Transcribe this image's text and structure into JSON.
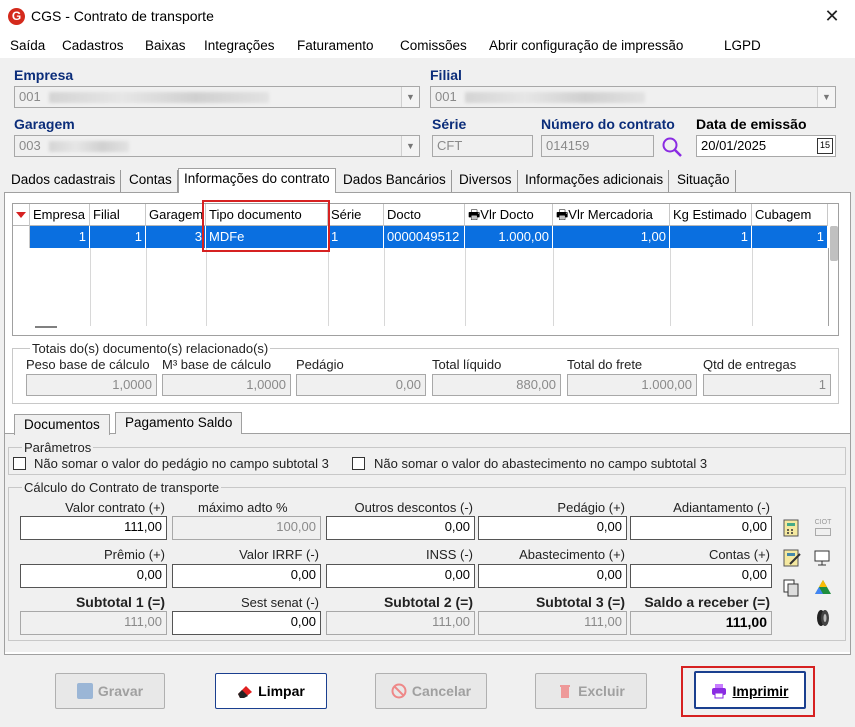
{
  "window": {
    "title": "CGS - Contrato de transporte",
    "close": "✕"
  },
  "menu": [
    "Saída",
    "Cadastros",
    "Baixas",
    "Integrações",
    "Faturamento",
    "Comissões",
    "Abrir configuração de impressão",
    "LGPD"
  ],
  "header": {
    "empresa_label": "Empresa",
    "empresa_value": "001",
    "filial_label": "Filial",
    "filial_value": "001",
    "garagem_label": "Garagem",
    "garagem_value": "003",
    "serie_label": "Série",
    "serie_value": "CFT",
    "numero_label": "Número do contrato",
    "numero_value": "014159",
    "data_label": "Data de emissão",
    "data_value": "20/01/2025",
    "calendar_day": "15"
  },
  "tabs": [
    "Dados cadastrais",
    "Contas",
    "Informações do contrato",
    "Dados Bancários",
    "Diversos",
    "Informações adicionais",
    "Situação"
  ],
  "grid": {
    "columns": [
      "Empresa",
      "Filial",
      "Garagem",
      "Tipo documento",
      "Série",
      "Docto",
      "Vlr Docto",
      "Vlr Mercadoria",
      "Kg Estimado",
      "Cubagem"
    ],
    "rows": [
      [
        "1",
        "1",
        "3",
        "MDFe",
        "1",
        "0000049512",
        "1.000,00",
        "1,00",
        "1",
        "1"
      ]
    ]
  },
  "totais": {
    "title": "Totais do(s) documento(s) relacionado(s)",
    "labels": [
      "Peso base de cálculo",
      "M³ base de cálculo",
      "Pedágio",
      "Total líquido",
      "Total do frete",
      "Qtd de entregas"
    ],
    "values": [
      "1,0000",
      "1,0000",
      "0,00",
      "880,00",
      "1.000,00",
      "1"
    ]
  },
  "subtabs": [
    "Documentos",
    "Pagamento Saldo"
  ],
  "parametros": {
    "title": "Parâmetros",
    "check1": "Não somar o valor do pedágio no campo subtotal 3",
    "check2": "Não somar o valor do abastecimento no campo subtotal 3"
  },
  "calculo": {
    "title": "Cálculo do Contrato de transporte",
    "row1_labels": [
      "Valor contrato (+)",
      "máximo adto %",
      "Outros descontos (-)",
      "Pedágio (+)",
      "Adiantamento (-)"
    ],
    "row1_values": [
      "111,00",
      "100,00",
      "0,00",
      "0,00",
      "0,00"
    ],
    "row2_labels": [
      "Prêmio (+)",
      "Valor IRRF (-)",
      "INSS (-)",
      "Abastecimento (+)",
      "Contas (+)"
    ],
    "row2_values": [
      "0,00",
      "0,00",
      "0,00",
      "0,00",
      "0,00"
    ],
    "row3_labels": [
      "Subtotal 1 (=)",
      "Sest senat (-)",
      "Subtotal 2 (=)",
      "Subtotal 3 (=)",
      "Saldo a receber (=)"
    ],
    "row3_values": [
      "111,00",
      "0,00",
      "111,00",
      "111,00",
      "111,00"
    ],
    "ciot_label": "CIOT"
  },
  "buttons": {
    "gravar": "Gravar",
    "limpar": "Limpar",
    "cancelar": "Cancelar",
    "excluir": "Excluir",
    "imprimir": "Imprimir"
  },
  "colors": {
    "selection": "#0a6fe0",
    "label_blue": "#0b2d7a",
    "highlight_red": "#d62121"
  }
}
